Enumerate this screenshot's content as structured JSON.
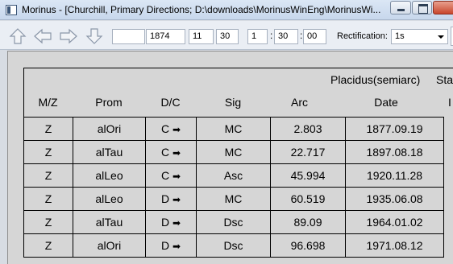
{
  "window": {
    "title": "Morinus - [Churchill, Primary Directions; D:\\downloads\\MorinusWinEng\\MorinusWi..."
  },
  "toolbar": {
    "year": "1874",
    "month": "11",
    "day": "30",
    "hour": "1",
    "minute": "30",
    "second": "00",
    "time_sep": ":",
    "rectification_label": "Rectification:",
    "rectification_value": "1s"
  },
  "table": {
    "group_header": "Placidus(semiarc)",
    "group_header_partial": "Sta",
    "columns": [
      "M/Z",
      "Prom",
      "D/C",
      "Sig",
      "Arc",
      "Date"
    ],
    "rows": [
      [
        "Z",
        "alOri",
        "C",
        "MC",
        "2.803",
        "1877.09.19"
      ],
      [
        "Z",
        "alTau",
        "C",
        "MC",
        "22.717",
        "1897.08.18"
      ],
      [
        "Z",
        "alLeo",
        "C",
        "Asc",
        "45.994",
        "1920.11.28"
      ],
      [
        "Z",
        "alLeo",
        "D",
        "MC",
        "60.519",
        "1935.06.08"
      ],
      [
        "Z",
        "alTau",
        "D",
        "Dsc",
        "89.09",
        "1964.01.02"
      ],
      [
        "Z",
        "alOri",
        "D",
        "Dsc",
        "96.698",
        "1971.08.12"
      ]
    ],
    "direction_arrow": "➡"
  }
}
